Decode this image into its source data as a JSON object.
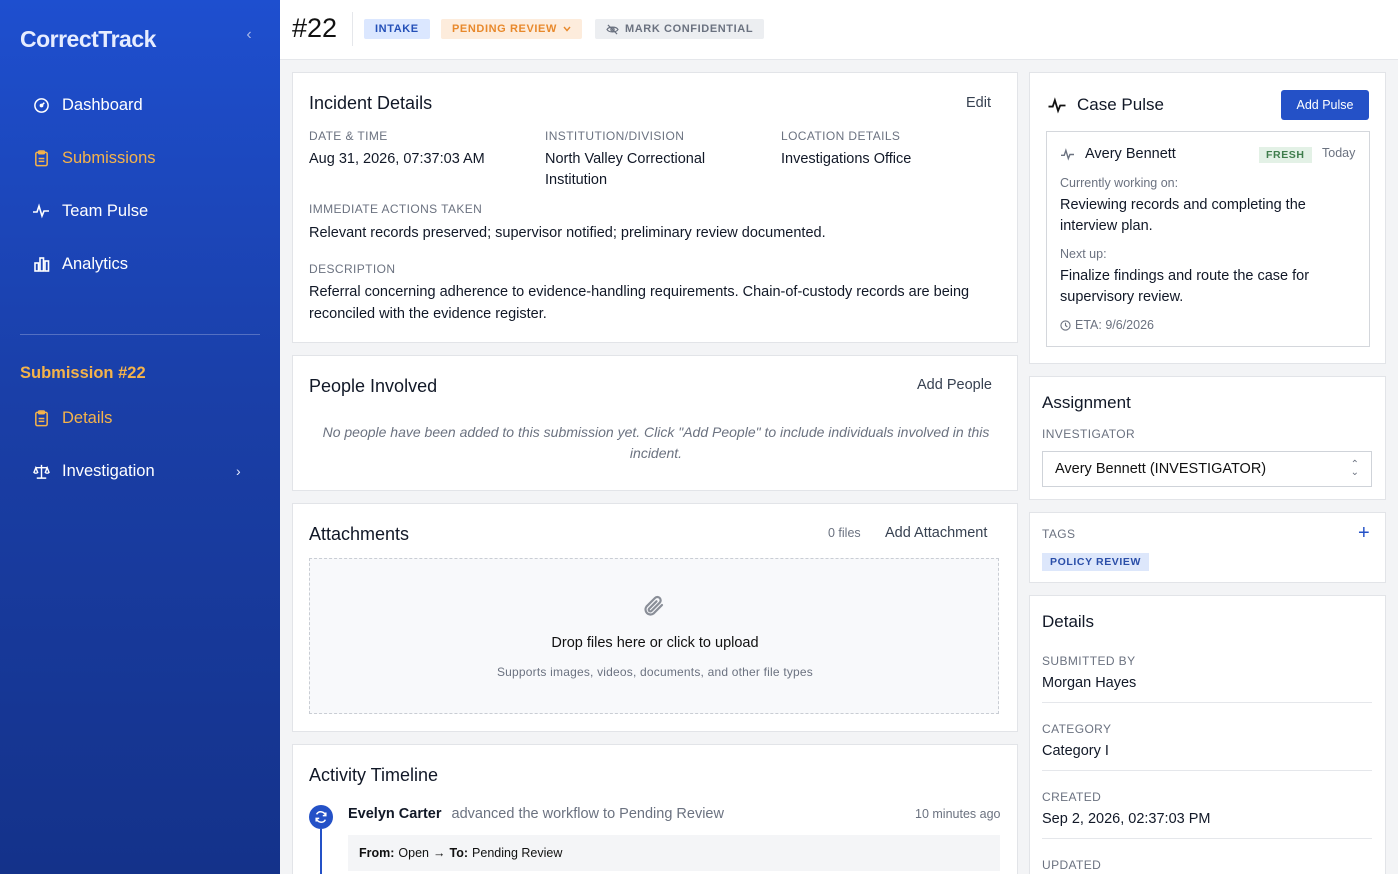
{
  "app": {
    "brand": "CorrectTrack"
  },
  "sidebar": {
    "items": [
      {
        "label": "Dashboard",
        "icon": "gauge-icon"
      },
      {
        "label": "Submissions",
        "icon": "clipboard-icon"
      },
      {
        "label": "Team Pulse",
        "icon": "pulse-icon"
      },
      {
        "label": "Analytics",
        "icon": "bar-chart-icon"
      }
    ],
    "section_title": "Submission #22",
    "sub_items": [
      {
        "label": "Details",
        "icon": "clipboard-icon"
      },
      {
        "label": "Investigation",
        "icon": "scale-icon"
      }
    ]
  },
  "header": {
    "case_number": "#22",
    "status_intake": "INTAKE",
    "status_pending": "PENDING REVIEW",
    "confidential": "MARK CONFIDENTIAL"
  },
  "incident": {
    "title": "Incident Details",
    "edit": "Edit",
    "date_label": "DATE & TIME",
    "date_value": "Aug 31, 2026, 07:37:03 AM",
    "inst_label": "INSTITUTION/DIVISION",
    "inst_value": "North Valley Correctional Institution",
    "loc_label": "LOCATION DETAILS",
    "loc_value": "Investigations Office",
    "actions_label": "IMMEDIATE ACTIONS TAKEN",
    "actions_value": "Relevant records preserved; supervisor notified; preliminary review documented.",
    "desc_label": "DESCRIPTION",
    "desc_value": "Referral concerning adherence to evidence-handling requirements. Chain-of-custody records are being reconciled with the evidence register."
  },
  "people": {
    "title": "People Involved",
    "add": "Add People",
    "empty": "No people have been added to this submission yet. Click \"Add People\" to include individuals involved in this incident."
  },
  "attachments": {
    "title": "Attachments",
    "count": "0 files",
    "add": "Add Attachment",
    "drop_title": "Drop files here or click to upload",
    "drop_sub": "Supports images, videos, documents, and other file types"
  },
  "timeline": {
    "title": "Activity Timeline",
    "entries": [
      {
        "actor": "Evelyn Carter",
        "action": "advanced the workflow to Pending Review",
        "time": "10 minutes ago",
        "from_label": "From:",
        "from_value": "Open",
        "arrow": "→",
        "to_label": "To:",
        "to_value": "Pending Review"
      }
    ]
  },
  "pulse": {
    "title": "Case Pulse",
    "add": "Add Pulse",
    "name": "Avery Bennett",
    "badge": "FRESH",
    "when": "Today",
    "working_label": "Currently working on:",
    "working_value": "Reviewing records and completing the interview plan.",
    "next_label": "Next up:",
    "next_value": "Finalize findings and route the case for supervisory review.",
    "eta": "ETA: 9/6/2026"
  },
  "assignment": {
    "title": "Assignment",
    "investigator_label": "INVESTIGATOR",
    "investigator_value": "Avery Bennett (INVESTIGATOR)"
  },
  "tags": {
    "label": "TAGS",
    "add": "+",
    "items": [
      "POLICY REVIEW"
    ]
  },
  "details": {
    "title": "Details",
    "submitted_by_label": "SUBMITTED BY",
    "submitted_by_value": "Morgan Hayes",
    "category_label": "CATEGORY",
    "category_value": "Category I",
    "created_label": "CREATED",
    "created_value": "Sep 2, 2026, 02:37:03 PM",
    "updated_label": "UPDATED"
  }
}
